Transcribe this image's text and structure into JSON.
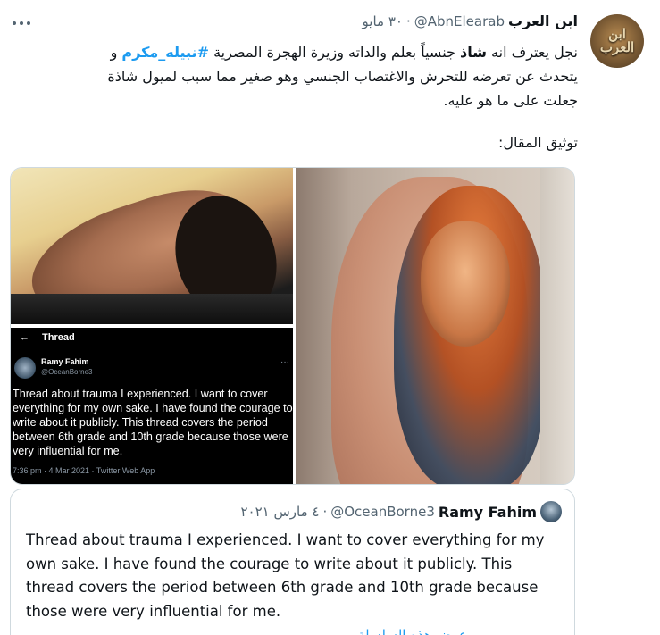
{
  "author": {
    "name": "ابن العرب",
    "handle": "@AbnElearab",
    "separator": "·",
    "date": "٣٠ مايو",
    "avatar_text": "ابن\nالعرب"
  },
  "body": {
    "line1_prefix": "نجل  يعترف انه ",
    "line1_strong": "شاذ",
    "line1_mid": " جنسياً بعلم والداته وزيرة الهجرة المصرية ",
    "hashtag": "#نبيله_مكرم",
    "line1_suffix": "  و",
    "line2": "يتحدث عن تعرضه للتحرش والاغتصاب الجنسي وهو صغير مما سبب لميول شاذة",
    "line3": "جعلت على ما هو عليه.",
    "source_label": "توثيق المقال:"
  },
  "media": {
    "thread_screenshot": {
      "back_arrow": "←",
      "title": "Thread",
      "name": "Ramy Fahim",
      "handle": "@OceanBorne3",
      "more": "···",
      "text": "Thread about trauma I experienced. I want to cover everything for my own sake. I have found the courage to write about it publicly. This thread covers the period between 6th grade and 10th grade because those were very influential for me.",
      "meta": "7:36 pm · 4 Mar 2021 · Twitter Web App"
    }
  },
  "quote": {
    "name": "Ramy Fahim",
    "handle": "@OceanBorne3",
    "separator": "·",
    "date": "٤ مارس ٢٠٢١",
    "text": "Thread about trauma I experienced. I want to cover everything for my own sake. I have found the courage to write about it publicly. This thread covers the period between 6th grade and 10th grade because those were very influential for me.",
    "show_thread": "عرض هذه السلسلة"
  },
  "colors": {
    "link": "#1d9bf0",
    "secondary_text": "#536471",
    "border": "#cfd9de"
  }
}
